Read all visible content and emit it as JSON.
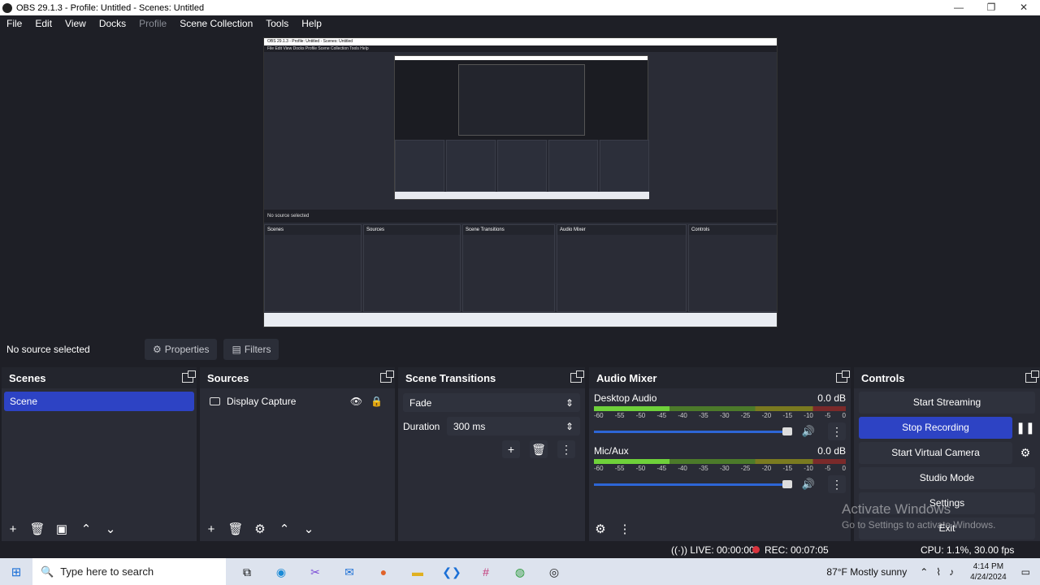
{
  "window": {
    "title": "OBS 29.1.3 - Profile: Untitled - Scenes: Untitled",
    "min_glyph": "—",
    "max_glyph": "❐",
    "close_glyph": "✕"
  },
  "menu": [
    "File",
    "Edit",
    "View",
    "Docks",
    "Profile",
    "Scene Collection",
    "Tools",
    "Help"
  ],
  "preview": {
    "title": "OBS 29.1.3 - Profile: Untitled - Scenes: Untitled",
    "menu": "File  Edit  View  Docks  Profile  Scene Collection  Tools  Help",
    "src_bar": "No source selected",
    "docks": [
      "Scenes",
      "Sources",
      "Scene Transitions",
      "Audio Mixer",
      "Controls"
    ],
    "watermark": "Activate Windows"
  },
  "source_bar": {
    "no_source": "No source selected",
    "properties_label": "Properties",
    "filters_label": "Filters"
  },
  "scenes": {
    "title": "Scenes",
    "items": [
      "Scene"
    ]
  },
  "sources": {
    "title": "Sources",
    "items": [
      "Display Capture"
    ]
  },
  "transitions": {
    "title": "Scene Transitions",
    "transition": "Fade",
    "duration_label": "Duration",
    "duration_value": "300 ms"
  },
  "mixer": {
    "title": "Audio Mixer",
    "ticks": [
      "-60",
      "-55",
      "-50",
      "-45",
      "-40",
      "-35",
      "-30",
      "-25",
      "-20",
      "-15",
      "-10",
      "-5",
      "0"
    ],
    "channels": [
      {
        "name": "Desktop Audio",
        "level": "0.0 dB"
      },
      {
        "name": "Mic/Aux",
        "level": "0.0 dB"
      }
    ]
  },
  "controls": {
    "title": "Controls",
    "start_streaming": "Start Streaming",
    "stop_recording": "Stop Recording",
    "start_virtual_camera": "Start Virtual Camera",
    "studio_mode": "Studio Mode",
    "settings": "Settings",
    "exit": "Exit"
  },
  "status": {
    "live": "LIVE: 00:00:00",
    "rec": "REC: 00:07:05",
    "cpu": "CPU: 1.1%, 30.00 fps"
  },
  "watermark": {
    "line1": "Activate Windows",
    "line2": "Go to Settings to activate Windows."
  },
  "taskbar": {
    "search_placeholder": "Type here to search",
    "weather": "87°F  Mostly sunny",
    "time": "4:14 PM",
    "date": "4/24/2024"
  },
  "colors": {
    "accent": "#2d43c4",
    "dock_bg": "#2a2c36",
    "window_bg": "#1e1f26",
    "rec_dot": "#d9343e"
  }
}
